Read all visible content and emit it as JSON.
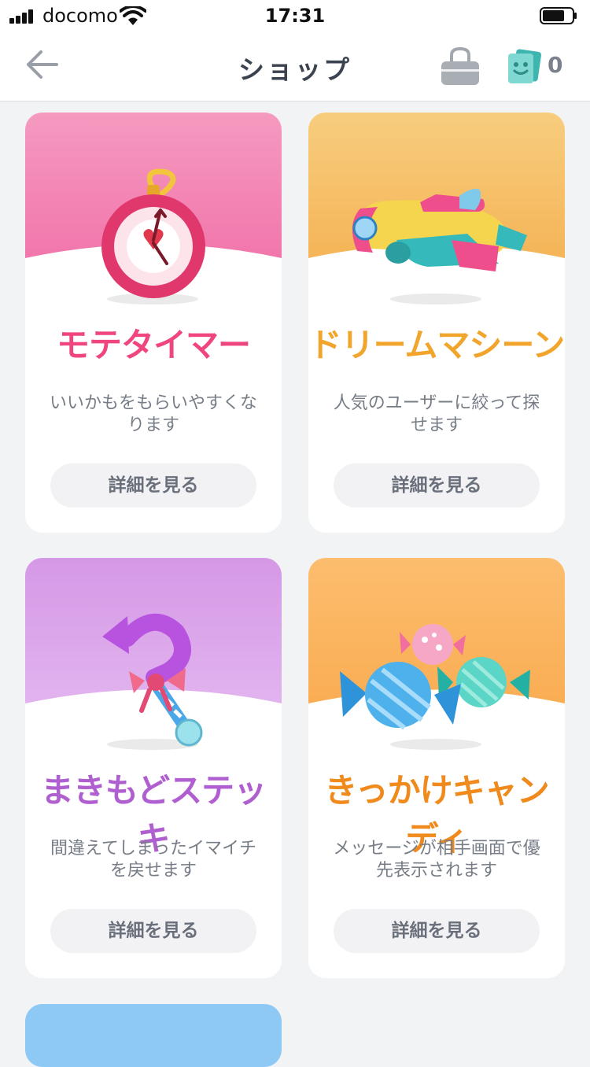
{
  "status_bar": {
    "carrier": "docomo",
    "time": "17:31"
  },
  "nav": {
    "title": "ショップ",
    "ticket_count": "0"
  },
  "items": [
    {
      "logo": "モテタイマー",
      "description": "いいかもをもらいやすくなります",
      "button": "詳細を見る",
      "logo_color": "#f0467f",
      "bg_color": "#f59ac0"
    },
    {
      "logo": "ドリームマシーン",
      "description": "人気のユーザーに絞って探せます",
      "button": "詳細を見る",
      "logo_color": "#f2a52c",
      "bg_color": "#f7c97a"
    },
    {
      "logo": "まきもどステッキ",
      "description": "間違えてしまったイマイチを戻せます",
      "button": "詳細を見る",
      "logo_color": "#b05fd0",
      "bg_color": "#d9a3ea"
    },
    {
      "logo": "きっかけキャンディ",
      "description": "メッセージが相手画面で優先表示されます",
      "button": "詳細を見る",
      "logo_color": "#f08a1c",
      "bg_color": "#fbb664"
    }
  ],
  "partial_card_color": "#8ec8f4"
}
